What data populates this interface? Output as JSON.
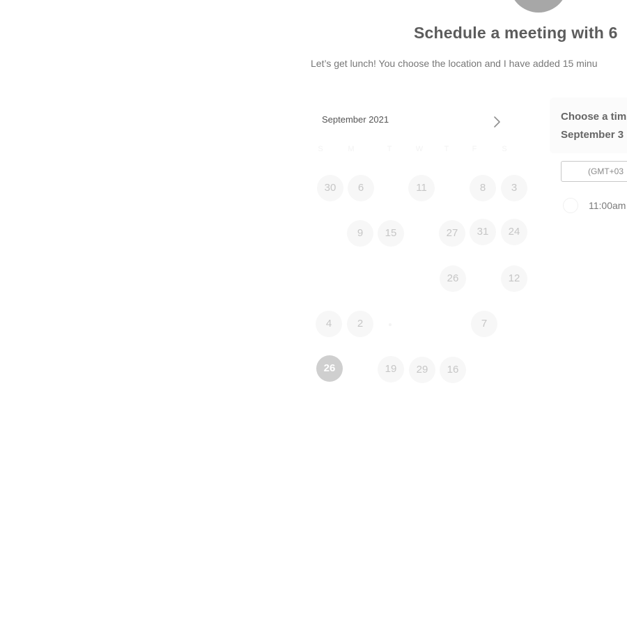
{
  "header": {
    "title": "Schedule a meeting with 6",
    "subtitle": "Let’s get lunch! You choose the location and I have added 15 minu"
  },
  "calendar": {
    "month_label": "September 2021",
    "next_icon": "chevron-right-icon",
    "weekdays": [
      "S",
      "M",
      "T",
      "W",
      "T",
      "F",
      "S"
    ],
    "days": [
      "30",
      "6",
      "11",
      "8",
      "3",
      "9",
      "15",
      "27",
      "31",
      "24",
      "26",
      "12",
      "4",
      "2",
      "7",
      "26",
      "19",
      "29",
      "16"
    ],
    "selected_day": "26"
  },
  "times": {
    "choose_label": "Choose a tim",
    "date_label": "September 3",
    "timezone": "(GMT+03",
    "slots": [
      "11:00am"
    ]
  },
  "colors": {
    "avatar": "#a7a7a7",
    "selected_day": "#cfcfcf"
  }
}
